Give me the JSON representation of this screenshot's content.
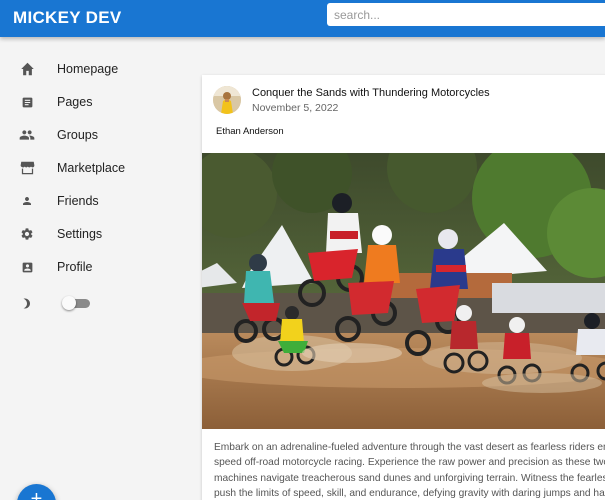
{
  "app": {
    "title": "MICKEY DEV"
  },
  "search": {
    "placeholder": "search...",
    "value": ""
  },
  "sidebar": {
    "items": [
      {
        "label": "Homepage",
        "icon": "home-icon"
      },
      {
        "label": "Pages",
        "icon": "article-icon"
      },
      {
        "label": "Groups",
        "icon": "group-icon"
      },
      {
        "label": "Marketplace",
        "icon": "storefront-icon"
      },
      {
        "label": "Friends",
        "icon": "person-icon"
      },
      {
        "label": "Settings",
        "icon": "gear-icon"
      },
      {
        "label": "Profile",
        "icon": "account-box-icon"
      }
    ],
    "theme_toggle": {
      "icon": "dark-mode-icon",
      "checked": false
    }
  },
  "post": {
    "title": "Conquer the Sands with Thundering Motorcycles",
    "date": "November 5, 2022",
    "author": "Ethan Anderson",
    "image": "motocross-riders-jumping-photo",
    "body_lines": [
      "Embark on an adrenaline-fueled adventure through the vast desert as fearless riders enga",
      "speed off-road motorcycle racing. Experience the raw power and precision as these two-w",
      "machines navigate treacherous sand dunes and unforgiving terrain. Witness the fearless r",
      "push the limits of speed, skill, and endurance, defying gravity with daring jumps and hairpi"
    ]
  },
  "fab": {
    "label": "+",
    "icon": "add-icon"
  },
  "colors": {
    "primary": "#1976d2",
    "background": "#f4f4f4",
    "card": "#ffffff"
  }
}
